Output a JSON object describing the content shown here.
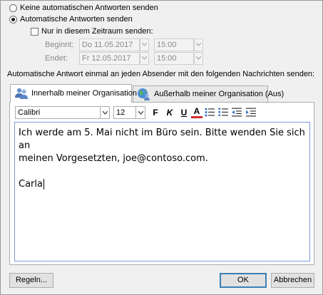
{
  "options": {
    "no_auto_reply": "Keine automatischen Antworten senden",
    "send_auto_reply": "Automatische Antworten senden",
    "only_time_range": "Nur in diesem Zeitraum senden:"
  },
  "schedule": {
    "start_label": "Beginnt:",
    "start_date": "Do 11.05.2017",
    "start_time": "15:00",
    "end_label": "Endet:",
    "end_date": "Fr 12.05.2017",
    "end_time": "15:00"
  },
  "instruction": "Automatische Antwort einmal an jeden Absender mit den folgenden Nachrichten senden:",
  "tabs": [
    {
      "label": "Innerhalb meiner Organisation"
    },
    {
      "label": "Außerhalb meiner Organisation (Aus)"
    }
  ],
  "toolbar": {
    "font": "Calibri",
    "size": "12",
    "bold": "F",
    "italic": "K",
    "underline": "U",
    "font_color": "A"
  },
  "message": {
    "line1": "Ich werde am 5. Mai nicht im Büro sein. Bitte wenden Sie sich an",
    "line2": "meinen Vorgesetzten, joe@contoso.com.",
    "signature": "Carla"
  },
  "buttons": {
    "rules": "Regeln...",
    "ok": "OK",
    "cancel": "Abbrechen"
  },
  "colors": {
    "font_color_accent": "#d32f2f",
    "list_accent": "#2f6fc4"
  }
}
